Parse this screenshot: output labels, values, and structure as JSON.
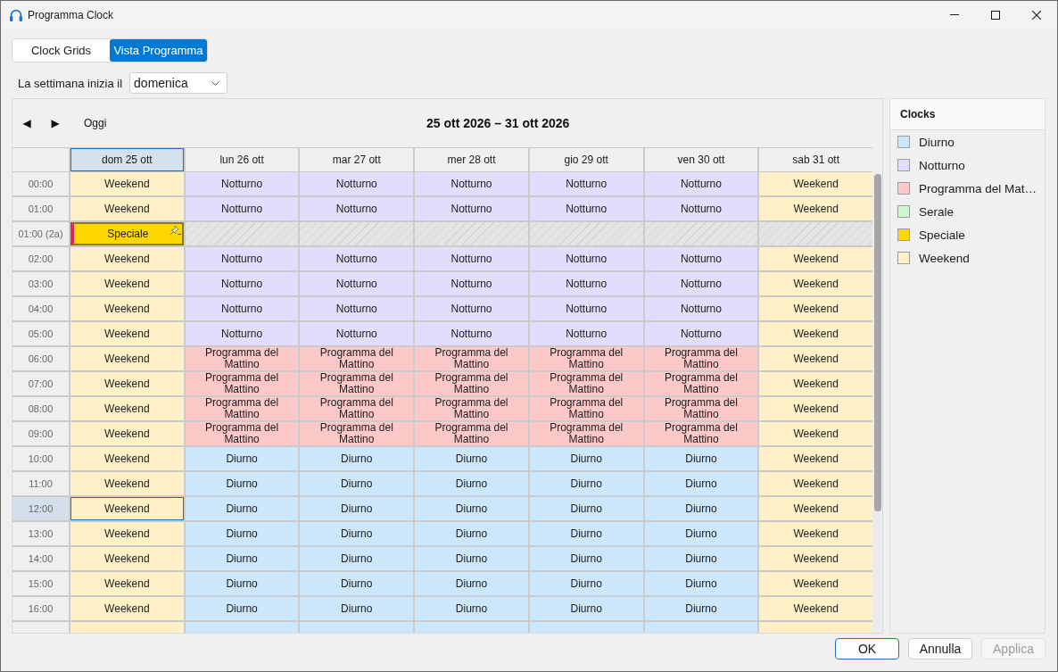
{
  "window": {
    "title": "Programma Clock"
  },
  "tabs": [
    {
      "label": "Clock Grids",
      "selected": false
    },
    {
      "label": "Vista Programma",
      "selected": true
    }
  ],
  "week_start": {
    "label": "La settimana inizia il",
    "value": "domenica"
  },
  "calendar": {
    "nav": {
      "prev": "◀",
      "next": "▶",
      "today": "Oggi"
    },
    "range": "25 ott 2026 – 31 ott 2026",
    "days": [
      {
        "label": "dom 25 ott",
        "selected": true
      },
      {
        "label": "lun 26 ott",
        "selected": false
      },
      {
        "label": "mar 27 ott",
        "selected": false
      },
      {
        "label": "mer 28 ott",
        "selected": false
      },
      {
        "label": "gio 29 ott",
        "selected": false
      },
      {
        "label": "ven 30 ott",
        "selected": false
      },
      {
        "label": "sab 31 ott",
        "selected": false
      }
    ],
    "rows": [
      {
        "time": "00:00",
        "selected": false,
        "cells": [
          {
            "kind": "clock",
            "label": "Weekend",
            "color": "#fff0c8",
            "selected": false
          },
          {
            "kind": "clock",
            "label": "Notturno",
            "color": "#e4dcfd",
            "selected": false
          },
          {
            "kind": "clock",
            "label": "Notturno",
            "color": "#e4dcfd",
            "selected": false
          },
          {
            "kind": "clock",
            "label": "Notturno",
            "color": "#e4dcfd",
            "selected": false
          },
          {
            "kind": "clock",
            "label": "Notturno",
            "color": "#e4dcfd",
            "selected": false
          },
          {
            "kind": "clock",
            "label": "Notturno",
            "color": "#e4dcfd",
            "selected": false
          },
          {
            "kind": "clock",
            "label": "Weekend",
            "color": "#fff0c8",
            "selected": false
          }
        ]
      },
      {
        "time": "01:00",
        "selected": false,
        "cells": [
          {
            "kind": "clock",
            "label": "Weekend",
            "color": "#fff0c8",
            "selected": false
          },
          {
            "kind": "clock",
            "label": "Notturno",
            "color": "#e4dcfd",
            "selected": false
          },
          {
            "kind": "clock",
            "label": "Notturno",
            "color": "#e4dcfd",
            "selected": false
          },
          {
            "kind": "clock",
            "label": "Notturno",
            "color": "#e4dcfd",
            "selected": false
          },
          {
            "kind": "clock",
            "label": "Notturno",
            "color": "#e4dcfd",
            "selected": false
          },
          {
            "kind": "clock",
            "label": "Notturno",
            "color": "#e4dcfd",
            "selected": false
          },
          {
            "kind": "clock",
            "label": "Weekend",
            "color": "#fff0c8",
            "selected": false
          }
        ]
      },
      {
        "time": "01:00 (2a)",
        "selected": false,
        "cells": [
          {
            "kind": "special",
            "label": "Speciale",
            "color": "#ffd700",
            "selected": false
          },
          {
            "kind": "gap",
            "selected": false
          },
          {
            "kind": "gap",
            "selected": false
          },
          {
            "kind": "gap",
            "selected": false
          },
          {
            "kind": "gap",
            "selected": false
          },
          {
            "kind": "gap",
            "selected": false
          },
          {
            "kind": "gap",
            "selected": false
          }
        ]
      },
      {
        "time": "02:00",
        "selected": false,
        "cells": [
          {
            "kind": "clock",
            "label": "Weekend",
            "color": "#fff0c8",
            "selected": false
          },
          {
            "kind": "clock",
            "label": "Notturno",
            "color": "#e4dcfd",
            "selected": false
          },
          {
            "kind": "clock",
            "label": "Notturno",
            "color": "#e4dcfd",
            "selected": false
          },
          {
            "kind": "clock",
            "label": "Notturno",
            "color": "#e4dcfd",
            "selected": false
          },
          {
            "kind": "clock",
            "label": "Notturno",
            "color": "#e4dcfd",
            "selected": false
          },
          {
            "kind": "clock",
            "label": "Notturno",
            "color": "#e4dcfd",
            "selected": false
          },
          {
            "kind": "clock",
            "label": "Weekend",
            "color": "#fff0c8",
            "selected": false
          }
        ]
      },
      {
        "time": "03:00",
        "selected": false,
        "cells": [
          {
            "kind": "clock",
            "label": "Weekend",
            "color": "#fff0c8",
            "selected": false
          },
          {
            "kind": "clock",
            "label": "Notturno",
            "color": "#e4dcfd",
            "selected": false
          },
          {
            "kind": "clock",
            "label": "Notturno",
            "color": "#e4dcfd",
            "selected": false
          },
          {
            "kind": "clock",
            "label": "Notturno",
            "color": "#e4dcfd",
            "selected": false
          },
          {
            "kind": "clock",
            "label": "Notturno",
            "color": "#e4dcfd",
            "selected": false
          },
          {
            "kind": "clock",
            "label": "Notturno",
            "color": "#e4dcfd",
            "selected": false
          },
          {
            "kind": "clock",
            "label": "Weekend",
            "color": "#fff0c8",
            "selected": false
          }
        ]
      },
      {
        "time": "04:00",
        "selected": false,
        "cells": [
          {
            "kind": "clock",
            "label": "Weekend",
            "color": "#fff0c8",
            "selected": false
          },
          {
            "kind": "clock",
            "label": "Notturno",
            "color": "#e4dcfd",
            "selected": false
          },
          {
            "kind": "clock",
            "label": "Notturno",
            "color": "#e4dcfd",
            "selected": false
          },
          {
            "kind": "clock",
            "label": "Notturno",
            "color": "#e4dcfd",
            "selected": false
          },
          {
            "kind": "clock",
            "label": "Notturno",
            "color": "#e4dcfd",
            "selected": false
          },
          {
            "kind": "clock",
            "label": "Notturno",
            "color": "#e4dcfd",
            "selected": false
          },
          {
            "kind": "clock",
            "label": "Weekend",
            "color": "#fff0c8",
            "selected": false
          }
        ]
      },
      {
        "time": "05:00",
        "selected": false,
        "cells": [
          {
            "kind": "clock",
            "label": "Weekend",
            "color": "#fff0c8",
            "selected": false
          },
          {
            "kind": "clock",
            "label": "Notturno",
            "color": "#e4dcfd",
            "selected": false
          },
          {
            "kind": "clock",
            "label": "Notturno",
            "color": "#e4dcfd",
            "selected": false
          },
          {
            "kind": "clock",
            "label": "Notturno",
            "color": "#e4dcfd",
            "selected": false
          },
          {
            "kind": "clock",
            "label": "Notturno",
            "color": "#e4dcfd",
            "selected": false
          },
          {
            "kind": "clock",
            "label": "Notturno",
            "color": "#e4dcfd",
            "selected": false
          },
          {
            "kind": "clock",
            "label": "Weekend",
            "color": "#fff0c8",
            "selected": false
          }
        ]
      },
      {
        "time": "06:00",
        "selected": false,
        "cells": [
          {
            "kind": "clock",
            "label": "Weekend",
            "color": "#fff0c8",
            "selected": false
          },
          {
            "kind": "clock",
            "label": "Programma del Mattino",
            "color": "#fdc8c8",
            "selected": false
          },
          {
            "kind": "clock",
            "label": "Programma del Mattino",
            "color": "#fdc8c8",
            "selected": false
          },
          {
            "kind": "clock",
            "label": "Programma del Mattino",
            "color": "#fdc8c8",
            "selected": false
          },
          {
            "kind": "clock",
            "label": "Programma del Mattino",
            "color": "#fdc8c8",
            "selected": false
          },
          {
            "kind": "clock",
            "label": "Programma del Mattino",
            "color": "#fdc8c8",
            "selected": false
          },
          {
            "kind": "clock",
            "label": "Weekend",
            "color": "#fff0c8",
            "selected": false
          }
        ]
      },
      {
        "time": "07:00",
        "selected": false,
        "cells": [
          {
            "kind": "clock",
            "label": "Weekend",
            "color": "#fff0c8",
            "selected": false
          },
          {
            "kind": "clock",
            "label": "Programma del Mattino",
            "color": "#fdc8c8",
            "selected": false
          },
          {
            "kind": "clock",
            "label": "Programma del Mattino",
            "color": "#fdc8c8",
            "selected": false
          },
          {
            "kind": "clock",
            "label": "Programma del Mattino",
            "color": "#fdc8c8",
            "selected": false
          },
          {
            "kind": "clock",
            "label": "Programma del Mattino",
            "color": "#fdc8c8",
            "selected": false
          },
          {
            "kind": "clock",
            "label": "Programma del Mattino",
            "color": "#fdc8c8",
            "selected": false
          },
          {
            "kind": "clock",
            "label": "Weekend",
            "color": "#fff0c8",
            "selected": false
          }
        ]
      },
      {
        "time": "08:00",
        "selected": false,
        "cells": [
          {
            "kind": "clock",
            "label": "Weekend",
            "color": "#fff0c8",
            "selected": false
          },
          {
            "kind": "clock",
            "label": "Programma del Mattino",
            "color": "#fdc8c8",
            "selected": false
          },
          {
            "kind": "clock",
            "label": "Programma del Mattino",
            "color": "#fdc8c8",
            "selected": false
          },
          {
            "kind": "clock",
            "label": "Programma del Mattino",
            "color": "#fdc8c8",
            "selected": false
          },
          {
            "kind": "clock",
            "label": "Programma del Mattino",
            "color": "#fdc8c8",
            "selected": false
          },
          {
            "kind": "clock",
            "label": "Programma del Mattino",
            "color": "#fdc8c8",
            "selected": false
          },
          {
            "kind": "clock",
            "label": "Weekend",
            "color": "#fff0c8",
            "selected": false
          }
        ]
      },
      {
        "time": "09:00",
        "selected": false,
        "cells": [
          {
            "kind": "clock",
            "label": "Weekend",
            "color": "#fff0c8",
            "selected": false
          },
          {
            "kind": "clock",
            "label": "Programma del Mattino",
            "color": "#fdc8c8",
            "selected": false
          },
          {
            "kind": "clock",
            "label": "Programma del Mattino",
            "color": "#fdc8c8",
            "selected": false
          },
          {
            "kind": "clock",
            "label": "Programma del Mattino",
            "color": "#fdc8c8",
            "selected": false
          },
          {
            "kind": "clock",
            "label": "Programma del Mattino",
            "color": "#fdc8c8",
            "selected": false
          },
          {
            "kind": "clock",
            "label": "Programma del Mattino",
            "color": "#fdc8c8",
            "selected": false
          },
          {
            "kind": "clock",
            "label": "Weekend",
            "color": "#fff0c8",
            "selected": false
          }
        ]
      },
      {
        "time": "10:00",
        "selected": false,
        "cells": [
          {
            "kind": "clock",
            "label": "Weekend",
            "color": "#fff0c8",
            "selected": false
          },
          {
            "kind": "clock",
            "label": "Diurno",
            "color": "#cce6fb",
            "selected": false
          },
          {
            "kind": "clock",
            "label": "Diurno",
            "color": "#cce6fb",
            "selected": false
          },
          {
            "kind": "clock",
            "label": "Diurno",
            "color": "#cce6fb",
            "selected": false
          },
          {
            "kind": "clock",
            "label": "Diurno",
            "color": "#cce6fb",
            "selected": false
          },
          {
            "kind": "clock",
            "label": "Diurno",
            "color": "#cce6fb",
            "selected": false
          },
          {
            "kind": "clock",
            "label": "Weekend",
            "color": "#fff0c8",
            "selected": false
          }
        ]
      },
      {
        "time": "11:00",
        "selected": false,
        "cells": [
          {
            "kind": "clock",
            "label": "Weekend",
            "color": "#fff0c8",
            "selected": false
          },
          {
            "kind": "clock",
            "label": "Diurno",
            "color": "#cce6fb",
            "selected": false
          },
          {
            "kind": "clock",
            "label": "Diurno",
            "color": "#cce6fb",
            "selected": false
          },
          {
            "kind": "clock",
            "label": "Diurno",
            "color": "#cce6fb",
            "selected": false
          },
          {
            "kind": "clock",
            "label": "Diurno",
            "color": "#cce6fb",
            "selected": false
          },
          {
            "kind": "clock",
            "label": "Diurno",
            "color": "#cce6fb",
            "selected": false
          },
          {
            "kind": "clock",
            "label": "Weekend",
            "color": "#fff0c8",
            "selected": false
          }
        ]
      },
      {
        "time": "12:00",
        "selected": true,
        "cells": [
          {
            "kind": "clock",
            "label": "Weekend",
            "color": "#fff0c8",
            "selected": true
          },
          {
            "kind": "clock",
            "label": "Diurno",
            "color": "#cce6fb",
            "selected": false
          },
          {
            "kind": "clock",
            "label": "Diurno",
            "color": "#cce6fb",
            "selected": false
          },
          {
            "kind": "clock",
            "label": "Diurno",
            "color": "#cce6fb",
            "selected": false
          },
          {
            "kind": "clock",
            "label": "Diurno",
            "color": "#cce6fb",
            "selected": false
          },
          {
            "kind": "clock",
            "label": "Diurno",
            "color": "#cce6fb",
            "selected": false
          },
          {
            "kind": "clock",
            "label": "Weekend",
            "color": "#fff0c8",
            "selected": false
          }
        ]
      },
      {
        "time": "13:00",
        "selected": false,
        "cells": [
          {
            "kind": "clock",
            "label": "Weekend",
            "color": "#fff0c8",
            "selected": false
          },
          {
            "kind": "clock",
            "label": "Diurno",
            "color": "#cce6fb",
            "selected": false
          },
          {
            "kind": "clock",
            "label": "Diurno",
            "color": "#cce6fb",
            "selected": false
          },
          {
            "kind": "clock",
            "label": "Diurno",
            "color": "#cce6fb",
            "selected": false
          },
          {
            "kind": "clock",
            "label": "Diurno",
            "color": "#cce6fb",
            "selected": false
          },
          {
            "kind": "clock",
            "label": "Diurno",
            "color": "#cce6fb",
            "selected": false
          },
          {
            "kind": "clock",
            "label": "Weekend",
            "color": "#fff0c8",
            "selected": false
          }
        ]
      },
      {
        "time": "14:00",
        "selected": false,
        "cells": [
          {
            "kind": "clock",
            "label": "Weekend",
            "color": "#fff0c8",
            "selected": false
          },
          {
            "kind": "clock",
            "label": "Diurno",
            "color": "#cce6fb",
            "selected": false
          },
          {
            "kind": "clock",
            "label": "Diurno",
            "color": "#cce6fb",
            "selected": false
          },
          {
            "kind": "clock",
            "label": "Diurno",
            "color": "#cce6fb",
            "selected": false
          },
          {
            "kind": "clock",
            "label": "Diurno",
            "color": "#cce6fb",
            "selected": false
          },
          {
            "kind": "clock",
            "label": "Diurno",
            "color": "#cce6fb",
            "selected": false
          },
          {
            "kind": "clock",
            "label": "Weekend",
            "color": "#fff0c8",
            "selected": false
          }
        ]
      },
      {
        "time": "15:00",
        "selected": false,
        "cells": [
          {
            "kind": "clock",
            "label": "Weekend",
            "color": "#fff0c8",
            "selected": false
          },
          {
            "kind": "clock",
            "label": "Diurno",
            "color": "#cce6fb",
            "selected": false
          },
          {
            "kind": "clock",
            "label": "Diurno",
            "color": "#cce6fb",
            "selected": false
          },
          {
            "kind": "clock",
            "label": "Diurno",
            "color": "#cce6fb",
            "selected": false
          },
          {
            "kind": "clock",
            "label": "Diurno",
            "color": "#cce6fb",
            "selected": false
          },
          {
            "kind": "clock",
            "label": "Diurno",
            "color": "#cce6fb",
            "selected": false
          },
          {
            "kind": "clock",
            "label": "Weekend",
            "color": "#fff0c8",
            "selected": false
          }
        ]
      },
      {
        "time": "16:00",
        "selected": false,
        "cells": [
          {
            "kind": "clock",
            "label": "Weekend",
            "color": "#fff0c8",
            "selected": false
          },
          {
            "kind": "clock",
            "label": "Diurno",
            "color": "#cce6fb",
            "selected": false
          },
          {
            "kind": "clock",
            "label": "Diurno",
            "color": "#cce6fb",
            "selected": false
          },
          {
            "kind": "clock",
            "label": "Diurno",
            "color": "#cce6fb",
            "selected": false
          },
          {
            "kind": "clock",
            "label": "Diurno",
            "color": "#cce6fb",
            "selected": false
          },
          {
            "kind": "clock",
            "label": "Diurno",
            "color": "#cce6fb",
            "selected": false
          },
          {
            "kind": "clock",
            "label": "Weekend",
            "color": "#fff0c8",
            "selected": false
          }
        ]
      },
      {
        "selected": false,
        "cells": [
          {
            "kind": "clock",
            "color": "#fff0c8",
            "selected": false
          },
          {
            "kind": "clock",
            "color": "#cce6fb",
            "selected": false
          },
          {
            "kind": "clock",
            "color": "#cce6fb",
            "selected": false
          },
          {
            "kind": "clock",
            "color": "#cce6fb",
            "selected": false
          },
          {
            "kind": "clock",
            "color": "#cce6fb",
            "selected": false
          },
          {
            "kind": "clock",
            "color": "#cce6fb",
            "selected": false
          },
          {
            "kind": "clock",
            "color": "#fff0c8",
            "selected": false
          }
        ]
      }
    ]
  },
  "legend": {
    "title": "Clocks",
    "items": [
      {
        "label": "Diurno",
        "color": "#cce6fb"
      },
      {
        "label": "Notturno",
        "color": "#e4dcfd"
      },
      {
        "label": "Programma del Mat…",
        "color": "#fdc8c8"
      },
      {
        "label": "Serale",
        "color": "#cdf7cf"
      },
      {
        "label": "Speciale",
        "color": "#ffd700"
      },
      {
        "label": "Weekend",
        "color": "#fff0c8"
      }
    ]
  },
  "buttons": [
    {
      "label": "OK",
      "default": true,
      "disabled": false
    },
    {
      "label": "Annulla",
      "default": false,
      "disabled": false
    },
    {
      "label": "Applica",
      "default": false,
      "disabled": true
    }
  ]
}
